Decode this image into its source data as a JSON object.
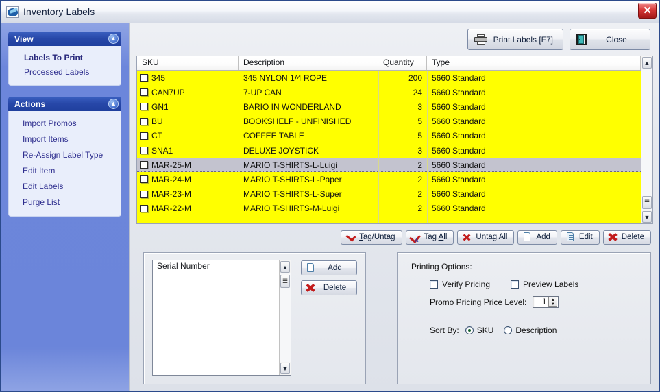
{
  "window": {
    "title": "Inventory Labels",
    "app_icon": "inventory-app-icon",
    "close_label": "✕"
  },
  "sidebar": {
    "panels": [
      {
        "title": "View",
        "collapse_icon": "«",
        "items": [
          {
            "label": "Labels To Print",
            "active": true
          },
          {
            "label": "Processed Labels",
            "active": false
          }
        ]
      },
      {
        "title": "Actions",
        "collapse_icon": "«",
        "items": [
          {
            "label": "Import Promos",
            "active": false
          },
          {
            "label": "Import Items",
            "active": false
          },
          {
            "label": "Re-Assign Label Type",
            "active": false
          },
          {
            "label": "Edit Item",
            "active": false
          },
          {
            "label": "Edit Labels",
            "active": false
          },
          {
            "label": "Purge List",
            "active": false
          }
        ]
      }
    ]
  },
  "toolbar": {
    "print_labels_label": "Print Labels [F7]",
    "close_label": "Close"
  },
  "grid": {
    "columns": [
      "SKU",
      "Description",
      "Quantity",
      "Type"
    ],
    "rows": [
      {
        "sku": "345",
        "description": "345 NYLON 1/4 ROPE",
        "quantity": "200",
        "type": "5660 Standard",
        "checked": false,
        "selected": false
      },
      {
        "sku": "CAN7UP",
        "description": "7-UP CAN",
        "quantity": "24",
        "type": "5660 Standard",
        "checked": false,
        "selected": false
      },
      {
        "sku": "GN1",
        "description": "BARIO IN WONDERLAND",
        "quantity": "3",
        "type": "5660 Standard",
        "checked": false,
        "selected": false
      },
      {
        "sku": "BU",
        "description": "BOOKSHELF - UNFINISHED",
        "quantity": "5",
        "type": "5660 Standard",
        "checked": false,
        "selected": false
      },
      {
        "sku": "CT",
        "description": "COFFEE TABLE",
        "quantity": "5",
        "type": "5660 Standard",
        "checked": false,
        "selected": false
      },
      {
        "sku": "SNA1",
        "description": "DELUXE JOYSTICK",
        "quantity": "3",
        "type": "5660 Standard",
        "checked": false,
        "selected": false
      },
      {
        "sku": "MAR-25-M",
        "description": "MARIO T-SHIRTS-L-Luigi",
        "quantity": "2",
        "type": "5660 Standard",
        "checked": false,
        "selected": true
      },
      {
        "sku": "MAR-24-M",
        "description": "MARIO T-SHIRTS-L-Paper",
        "quantity": "2",
        "type": "5660 Standard",
        "checked": false,
        "selected": false
      },
      {
        "sku": "MAR-23-M",
        "description": "MARIO T-SHIRTS-L-Super",
        "quantity": "2",
        "type": "5660 Standard",
        "checked": false,
        "selected": false
      },
      {
        "sku": "MAR-22-M",
        "description": "MARIO T-SHIRTS-M-Luigi",
        "quantity": "2",
        "type": "5660 Standard",
        "checked": false,
        "selected": false
      }
    ],
    "scroll_up_icon": "▲",
    "scroll_down_icon": "▼",
    "row_highlight_color": "#c3c3cf",
    "row_background_color": "#ffff00"
  },
  "grid_actions": [
    {
      "label": "Tag/Untag",
      "icon": "tag-icon"
    },
    {
      "label": "Tag All",
      "icon": "tag-all-icon"
    },
    {
      "label": "Untag All",
      "icon": "untag-all-icon"
    },
    {
      "label": "Add",
      "icon": "page-add-icon"
    },
    {
      "label": "Edit",
      "icon": "page-edit-icon"
    },
    {
      "label": "Delete",
      "icon": "delete-x-icon"
    }
  ],
  "serial": {
    "column_header": "Serial Number",
    "rows": [],
    "add_label": "Add",
    "delete_label": "Delete",
    "scroll_up_icon": "▲",
    "scroll_down_icon": "▼"
  },
  "printing": {
    "title": "Printing Options:",
    "verify_pricing_label": "Verify Pricing",
    "verify_pricing_checked": false,
    "preview_labels_label": "Preview Labels",
    "preview_labels_checked": false,
    "promo_label": "Promo Pricing Price Level:",
    "promo_value": "1",
    "sort_by_label": "Sort By:",
    "sort_options": [
      {
        "label": "SKU",
        "selected": true
      },
      {
        "label": "Description",
        "selected": false
      }
    ]
  }
}
